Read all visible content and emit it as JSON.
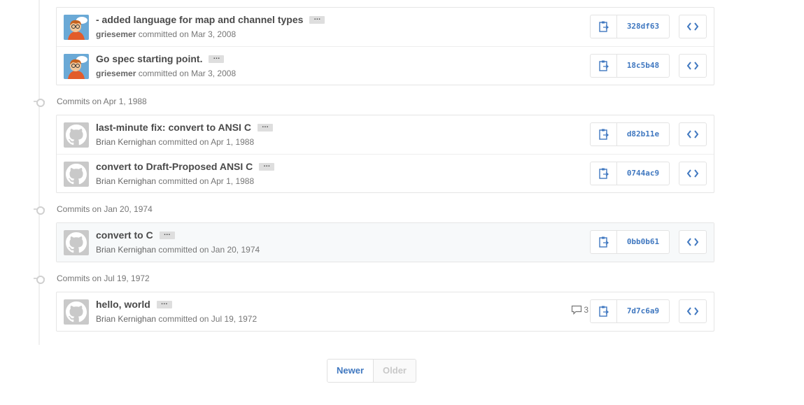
{
  "groups": [
    {
      "header": "",
      "commits": [
        {
          "message": "- added language for map and channel types",
          "author": "griesemer",
          "action": "committed on Mar 3, 2008",
          "sha": "328df63",
          "avatar": "cartoon"
        },
        {
          "message": "Go spec starting point.",
          "author": "griesemer",
          "action": "committed on Mar 3, 2008",
          "sha": "18c5b48",
          "avatar": "cartoon"
        }
      ]
    },
    {
      "header": "Commits on Apr 1, 1988",
      "commits": [
        {
          "message": "last-minute fix: convert to ANSI C",
          "author": "Brian Kernighan",
          "action": "committed on Apr 1, 1988",
          "sha": "d82b11e",
          "avatar": "github"
        },
        {
          "message": "convert to Draft-Proposed ANSI C",
          "author": "Brian Kernighan",
          "action": "committed on Apr 1, 1988",
          "sha": "0744ac9",
          "avatar": "github"
        }
      ]
    },
    {
      "header": "Commits on Jan 20, 1974",
      "commits": [
        {
          "message": "convert to C",
          "author": "Brian Kernighan",
          "action": "committed on Jan 20, 1974",
          "sha": "0bb0b61",
          "avatar": "github"
        }
      ]
    },
    {
      "header": "Commits on Jul 19, 1972",
      "commits": [
        {
          "message": "hello, world",
          "author": "Brian Kernighan",
          "action": "committed on Jul 19, 1972",
          "sha": "7d7c6a9",
          "avatar": "github",
          "comment_count": "3"
        }
      ]
    }
  ],
  "ellipsis_label": "…",
  "pagination": {
    "newer": "Newer",
    "older": "Older"
  },
  "colors": {
    "link": "#4078c0",
    "muted": "#767676",
    "border": "#e5e5e5"
  },
  "icons": {
    "copy": "clipboard-icon",
    "browse": "code-icon",
    "comment": "comment-icon",
    "avatar_default": "github-octocat-icon"
  }
}
